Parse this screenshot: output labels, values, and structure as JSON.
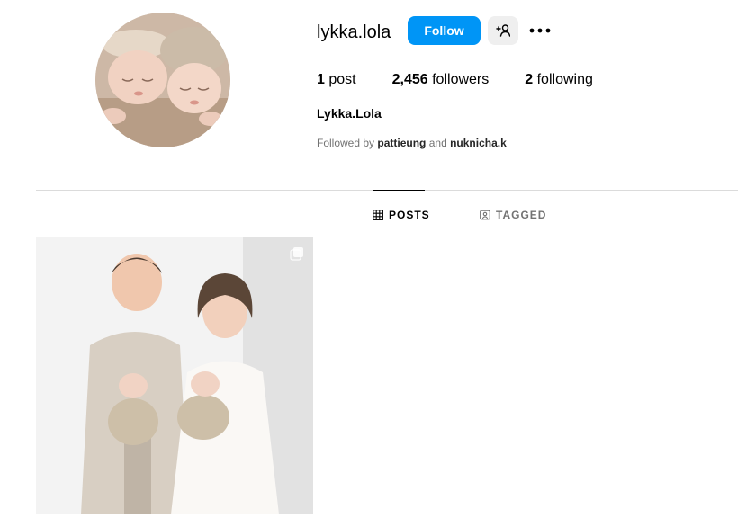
{
  "profile": {
    "username": "lykka.lola",
    "display_name": "Lykka.Lola",
    "follow_label": "Follow",
    "avatar_icon": "profile-avatar-photo",
    "suggest_icon": "add-person-icon",
    "more_icon": "more-options-icon"
  },
  "stats": {
    "posts_count": "1",
    "posts_label": "post",
    "followers_count": "2,456",
    "followers_label": "followers",
    "following_count": "2",
    "following_label": "following"
  },
  "followed_by": {
    "prefix": "Followed by",
    "account_1": "pattieung",
    "joiner": "and",
    "account_2": "nuknicha.k"
  },
  "tabs": [
    {
      "label": "POSTS",
      "icon": "grid-icon",
      "active": true
    },
    {
      "label": "TAGGED",
      "icon": "tagged-icon",
      "active": false
    }
  ],
  "posts": [
    {
      "icon": "multiple-photos-icon",
      "type": "carousel"
    }
  ],
  "colors": {
    "accent": "#0095f6",
    "secondary_button": "#efefef",
    "muted_text": "#737373",
    "divider": "#dbdbdb"
  }
}
